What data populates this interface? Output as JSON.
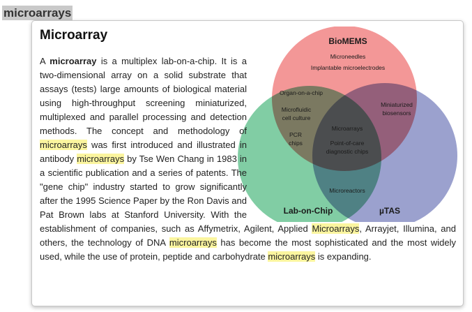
{
  "search_term": "microarrays",
  "popup": {
    "title": "Microarray",
    "article_segments": [
      {
        "text": "A ",
        "highlight": false,
        "bold": false
      },
      {
        "text": "microarray",
        "highlight": false,
        "bold": true
      },
      {
        "text": " is a multiplex lab-on-a-chip. It is a two-dimensional array on a solid substrate that assays (tests) large amounts of biological material using high-throughput screening miniaturized, multiplexed and parallel processing and detection methods. The concept and methodology of ",
        "highlight": false,
        "bold": false
      },
      {
        "text": "microarrays",
        "highlight": true,
        "bold": false
      },
      {
        "text": " was first introduced and illustrated in antibody ",
        "highlight": false,
        "bold": false
      },
      {
        "text": "microarrays",
        "highlight": true,
        "bold": false
      },
      {
        "text": " by Tse Wen Chang in 1983 in a scientific publication and a series of patents. The \"gene chip\" industry started to grow significantly after the 1995 Science Paper by the Ron Davis and Pat Brown labs at Stanford University. With the establishment of companies, such as Affymetrix, Agilent, Applied ",
        "highlight": false,
        "bold": false
      },
      {
        "text": "Microarrays",
        "highlight": true,
        "bold": false
      },
      {
        "text": ", Arrayjet, Illumina, and others, the technology of DNA ",
        "highlight": false,
        "bold": false
      },
      {
        "text": "microarrays",
        "highlight": true,
        "bold": false
      },
      {
        "text": " has become the most sophisticated and the most widely used, while the use of protein, peptide and carbohydrate ",
        "highlight": false,
        "bold": false
      },
      {
        "text": "microarrays",
        "highlight": true,
        "bold": false
      },
      {
        "text": " is expanding.",
        "highlight": false,
        "bold": false
      }
    ],
    "diagram": {
      "circles": {
        "biomems": {
          "label": "BioMEMS",
          "color": "#f08080"
        },
        "lab_on_chip": {
          "label": "Lab-on-Chip",
          "color": "#5ebf8a"
        },
        "utas": {
          "label": "µTAS",
          "color": "#7f86c0"
        }
      },
      "regions": {
        "biomems_only_1": "Microneedles",
        "biomems_only_2": "Implantable microelectrodes",
        "biomems_loc": "Organ-on-a-chip",
        "biomems_utas_1": "Miniaturized",
        "biomems_utas_2": "biosensors",
        "loc_a1": "Microfluidic",
        "loc_a2": "cell culture",
        "loc_b1": "PCR",
        "loc_b2": "chips",
        "center_1": "Microarrays",
        "center_2": "Point-of-care",
        "center_3": "diagnostic chips",
        "loc_utas": "Microreactors"
      },
      "highlight_color": "#fbf59f"
    }
  }
}
